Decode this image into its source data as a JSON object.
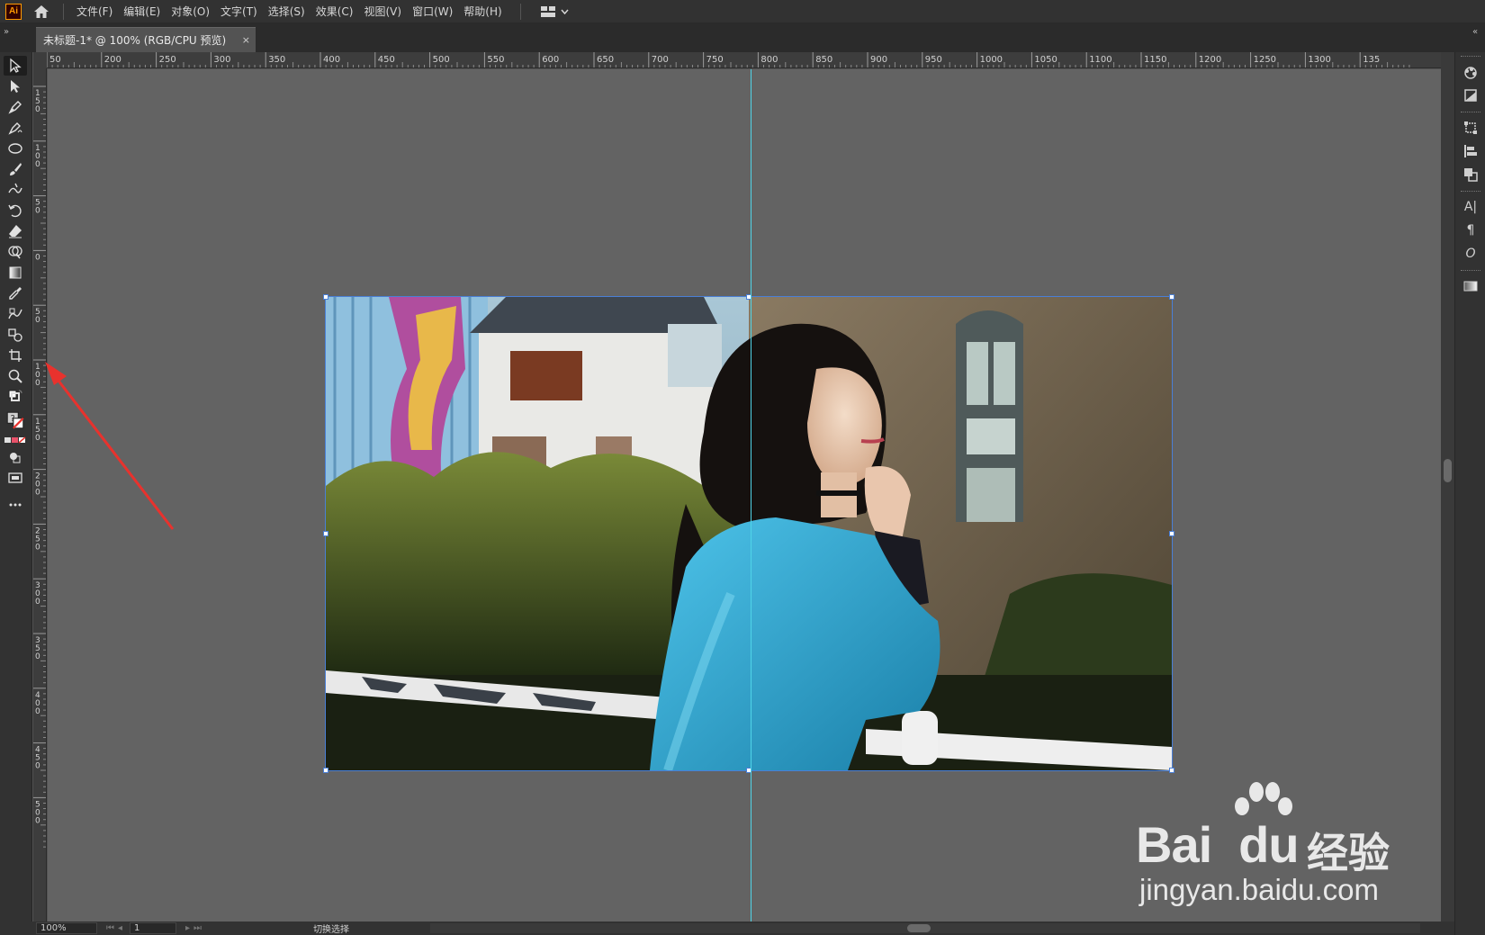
{
  "app": {
    "logo": "Ai",
    "menu": [
      "文件(F)",
      "编辑(E)",
      "对象(O)",
      "文字(T)",
      "选择(S)",
      "效果(C)",
      "视图(V)",
      "窗口(W)",
      "帮助(H)"
    ]
  },
  "document_tab": {
    "title": "未标题-1* @ 100% (RGB/CPU 预览)",
    "close": "×"
  },
  "ruler_top_labels": [
    "50",
    "200",
    "250",
    "300",
    "350",
    "400",
    "450",
    "500",
    "550",
    "600",
    "650",
    "700",
    "750",
    "800",
    "850",
    "900",
    "950",
    "1000",
    "1050",
    "1100",
    "1150",
    "1200",
    "1250",
    "1300",
    "135"
  ],
  "ruler_left_labels": [
    "150",
    "100",
    "50",
    "0",
    "50",
    "100",
    "150",
    "200",
    "250",
    "300",
    "350",
    "400",
    "450",
    "500"
  ],
  "tools": [
    "selection-tool",
    "direct-selection-tool",
    "pen-tool",
    "curvature-tool",
    "ellipse-tool",
    "paintbrush-tool",
    "shaper-tool",
    "rotate-tool",
    "eraser-tool",
    "shape-builder-tool",
    "gradient-tool",
    "eyedropper-tool",
    "blend-tool",
    "symbol-sprayer-tool",
    "artboard-tool",
    "zoom-tool"
  ],
  "status_bar": {
    "zoom": "100%",
    "page": "1",
    "status": "切换选择"
  },
  "right_panel_icons": [
    "color-guide-icon",
    "image-trace-icon",
    "transform-icon",
    "align-icon",
    "pathfinder-icon",
    "character-icon",
    "paragraph-icon",
    "opentype-icon",
    "gradient-panel-icon"
  ],
  "right_panel_labels": {
    "character": "A|",
    "paragraph": "¶",
    "opentype": "O"
  },
  "watermark": {
    "brand": "Bai",
    "brand_du": "du",
    "cn": "经验",
    "url": "jingyan.baidu.com"
  },
  "colors": {
    "guide": "#4fd4e8",
    "selection": "#4a7fd6",
    "arrow": "#e8322d",
    "canvas": "#636363"
  }
}
